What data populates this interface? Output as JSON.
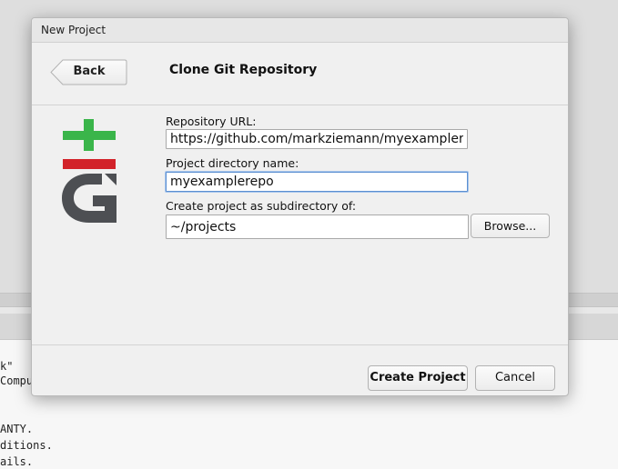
{
  "background": {
    "console_lines": [
      "k\"",
      "Compu",
      "",
      "ANTY.",
      "ditions.",
      "ails."
    ]
  },
  "dialog": {
    "title": "New Project",
    "back_label": "Back",
    "heading": "Clone Git Repository",
    "logo_icon": "git-logo-icon",
    "repo_url": {
      "label": "Repository URL:",
      "value": "https://github.com/markziemann/myexamplerep"
    },
    "project_dir": {
      "label": "Project directory name:",
      "value": "myexamplerepo"
    },
    "subdir": {
      "label": "Create project as subdirectory of:",
      "value": "~/projects",
      "browse_label": "Browse..."
    },
    "create_label": "Create Project",
    "cancel_label": "Cancel"
  },
  "colors": {
    "git_green": "#3ab54a",
    "git_red": "#d2232a",
    "git_gray": "#4d4f53",
    "focus_border": "#5b8fd1"
  }
}
